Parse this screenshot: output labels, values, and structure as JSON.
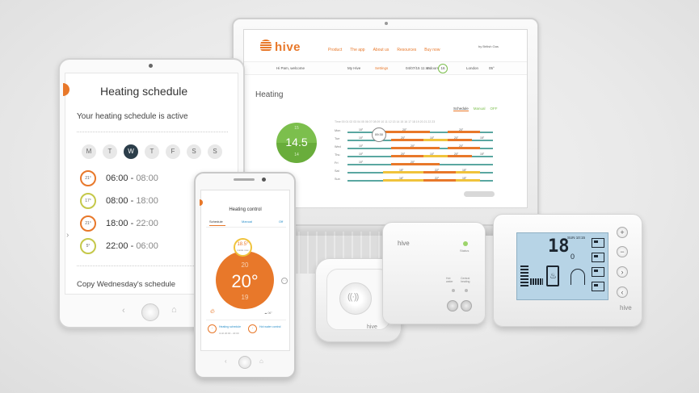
{
  "website": {
    "logo": "hive",
    "nav_links": [
      "Product",
      "The app",
      "About us",
      "Resources",
      "Buy now"
    ],
    "provider": "by British Gas",
    "welcome": "Hi Pam, welcome",
    "my_hive": "My Hive",
    "settings": "Settings",
    "date": "04/07/15 11:44",
    "indoors_label": "Indoors",
    "indoors_value": "16",
    "location": "London",
    "outdoor_temp": "05°",
    "heading": "Heating",
    "dial_top": "15",
    "dial_main": "14.5",
    "dial_bottom": "14",
    "tabs": [
      "Schedule",
      "Manual",
      "OFF"
    ],
    "time_header": "Time  00  01  02  03  04  05  06  07  08  09  10  11  12  13  14  15  16  17  18  19  20  21  22  23",
    "days": [
      {
        "label": "Mon",
        "vals": [
          "10°",
          "20°",
          "20°"
        ]
      },
      {
        "label": "Tue",
        "vals": [
          "10°",
          "20°",
          "10°",
          "20°",
          "15°"
        ]
      },
      {
        "label": "Wed",
        "vals": [
          "10°",
          "20°",
          "20°"
        ]
      },
      {
        "label": "Thu",
        "vals": [
          "10°",
          "20°",
          "10°",
          "20°",
          "15°"
        ]
      },
      {
        "label": "Fri",
        "vals": [
          "10°",
          "20°"
        ]
      },
      {
        "label": "Sat",
        "vals": [
          "15°",
          "22°",
          "15°"
        ]
      },
      {
        "label": "Sun",
        "vals": [
          "16°",
          "22°",
          "15°"
        ]
      }
    ],
    "bubble_time": "09:30"
  },
  "tablet": {
    "title": "Heating schedule",
    "subtitle": "Your heating schedule is active",
    "days": [
      "M",
      "T",
      "W",
      "T",
      "F",
      "S",
      "S"
    ],
    "active_day_index": 2,
    "slots": [
      {
        "temp": "21°",
        "start": "06:00",
        "end": "08:00",
        "color": "#e8782a"
      },
      {
        "temp": "17°",
        "start": "08:00",
        "end": "18:00",
        "color": "#c5c84a"
      },
      {
        "temp": "21°",
        "start": "18:00",
        "end": "22:00",
        "color": "#e8782a"
      },
      {
        "temp": "5°",
        "start": "22:00",
        "end": "06:00",
        "color": "#c5c84a"
      }
    ],
    "copy_label": "Copy Wednesday's schedule"
  },
  "phone": {
    "title": "Heating control",
    "tabs": [
      "Schedule",
      "Manual",
      "Off"
    ],
    "current_temp": "18.5°",
    "current_label": "inside now",
    "target_up": "20",
    "target": "20°",
    "target_down": "19",
    "weather": "06°",
    "controls": [
      {
        "label": "Heating schedule",
        "sub": "Until 20:00 - 22:00"
      },
      {
        "label": "Hot water control",
        "sub": ""
      }
    ]
  },
  "sensor": {
    "logo": "hive"
  },
  "hub": {
    "logo": "hive",
    "status_label": "Status",
    "hot_water": "Hot water",
    "central_heating": "Central heating"
  },
  "thermostat": {
    "temp": "18",
    "temp_decimal": "0",
    "day_time": "SUN  10:15",
    "logo": "hive"
  },
  "colors": {
    "accent_orange": "#e8782a",
    "accent_green": "#7cbf4d",
    "teal": "#5aa7a1",
    "yellow": "#f0c33c"
  }
}
